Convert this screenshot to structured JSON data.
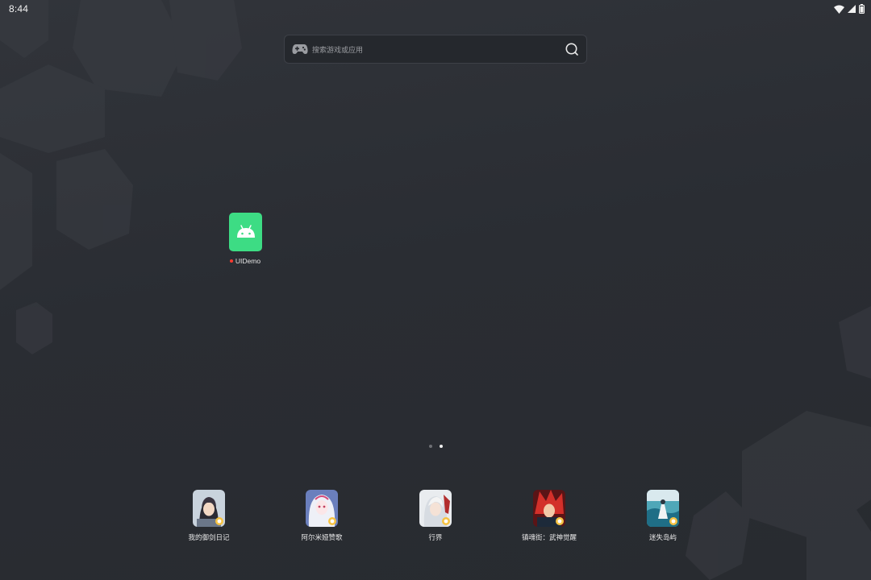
{
  "status_bar": {
    "time": "8:44",
    "icons": [
      "wifi-icon",
      "cellular-signal-icon",
      "battery-icon"
    ]
  },
  "search": {
    "placeholder": "搜索游戏或应用",
    "leading_icon": "gamepad-icon",
    "trailing_icon": "search-icon"
  },
  "home_apps": [
    {
      "label": "UIDemo",
      "icon": "android-robot-icon",
      "tile_color": "#3ddc84",
      "new_badge": true
    }
  ],
  "pager": {
    "page_count": 2,
    "active_page": 2
  },
  "dock": [
    {
      "label": "我的御剑日记",
      "icon": "game-art-icon"
    },
    {
      "label": "阿尔米娅赞歌",
      "icon": "game-art-icon"
    },
    {
      "label": "行界",
      "icon": "game-art-icon"
    },
    {
      "label": "镇魂街：武神觉醒",
      "icon": "game-art-icon"
    },
    {
      "label": "迷失岛屿",
      "icon": "game-art-icon"
    }
  ],
  "colors": {
    "wallpaper": "#2a2d32",
    "accent_android": "#3ddc84",
    "new_badge": "#ff3b30",
    "text": "#e6e6e6"
  }
}
